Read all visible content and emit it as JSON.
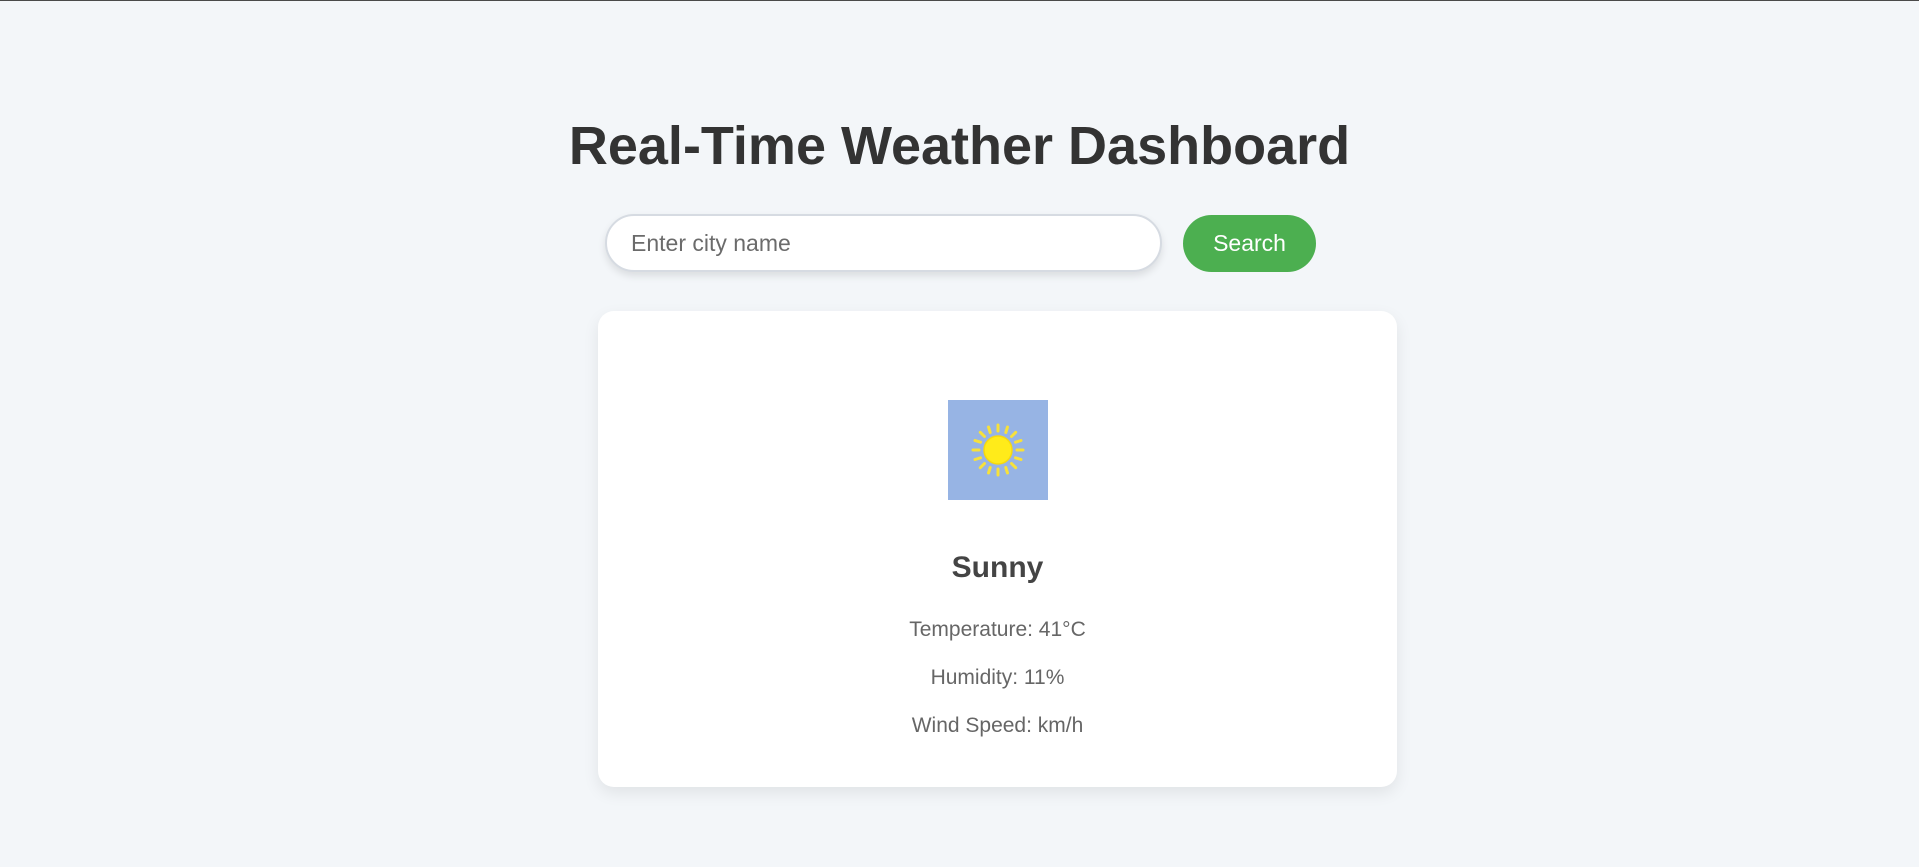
{
  "header": {
    "title": "Real-Time Weather Dashboard"
  },
  "search": {
    "placeholder": "Enter city name",
    "value": "",
    "button_label": "Search"
  },
  "weather": {
    "icon": "sun-icon",
    "condition": "Sunny",
    "temperature_text": "Temperature: 41°C",
    "humidity_text": "Humidity: 11%",
    "wind_text": "Wind Speed: km/h"
  },
  "colors": {
    "background": "#f3f6f9",
    "accent": "#4caf50",
    "icon_bg": "#97b4e4",
    "sun": "#ffeb3b"
  }
}
